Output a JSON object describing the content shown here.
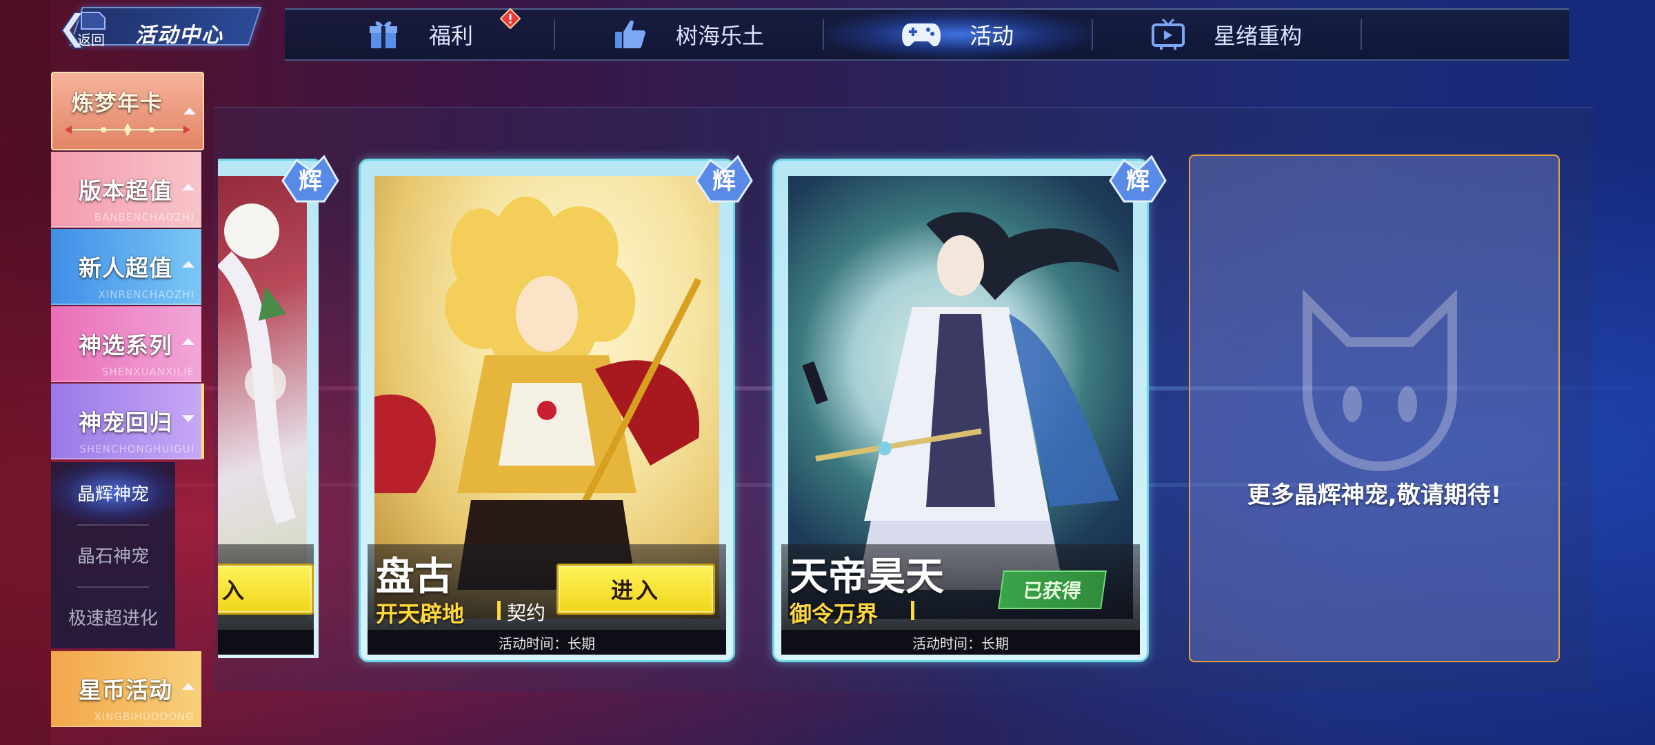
{
  "header": {
    "back_label": "返回",
    "title": "活动中心"
  },
  "tabs": [
    {
      "label": "福利",
      "icon": "gift-icon",
      "alert": true
    },
    {
      "label": "树海乐土",
      "icon": "thumbs-up-icon",
      "alert": false
    },
    {
      "label": "活动",
      "icon": "gamepad-icon",
      "active": true
    },
    {
      "label": "星绪重构",
      "icon": "tv-icon",
      "alert": false
    }
  ],
  "sidebar": {
    "categories": [
      {
        "title": "炼梦年卡",
        "sub": "",
        "arrow": "up",
        "color": "#f0a58c"
      },
      {
        "title": "版本超值",
        "sub": "BANBENCHAOZHI",
        "arrow": "up",
        "color": "#f7b7c4"
      },
      {
        "title": "新人超值",
        "sub": "XINRENCHAOZHI",
        "arrow": "up",
        "color": "#69b7f0"
      },
      {
        "title": "神选系列",
        "sub": "SHENXUANXILIE",
        "arrow": "up",
        "color": "#f08cc6"
      },
      {
        "title": "神宠回归",
        "sub": "SHENCHONGHUIGUI",
        "arrow": "down",
        "color": "#b294f0"
      },
      {
        "title": "星币活动",
        "sub": "XINGBIHUODONG",
        "arrow": "up",
        "color": "#f5c46a"
      }
    ],
    "sub_items": [
      {
        "label": "晶辉神宠",
        "active": true
      },
      {
        "label": "晶石神宠",
        "active": false
      },
      {
        "label": "极速超进化",
        "active": false
      }
    ]
  },
  "cards": [
    {
      "name": "",
      "sub": "",
      "button": "入",
      "footer": "",
      "partial": true
    },
    {
      "name": "盘古",
      "sub": "开天辟地",
      "extra": "契约",
      "button": "进入",
      "footer": "活动时间：长期",
      "badge": "辉"
    },
    {
      "name": "天帝昊天",
      "sub": "御令万界",
      "status": "已获得",
      "footer": "活动时间：长期",
      "badge": "辉"
    }
  ],
  "coming_soon": "更多晶辉神宠,敬请期待!",
  "colors": {
    "accent_blue": "#3c7cf0",
    "enter_yellow": "#f0d61a",
    "owned_green": "#3aa34a",
    "card_border": "#6fd6e6",
    "panel_border": "#e8a23a"
  }
}
